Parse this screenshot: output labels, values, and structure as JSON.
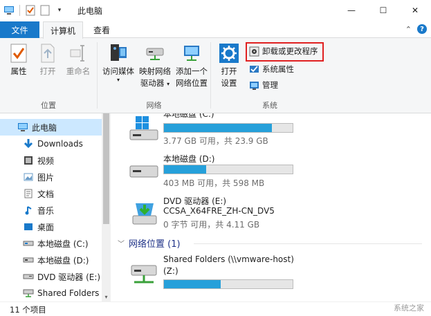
{
  "window": {
    "title": "此电脑",
    "controls": {
      "minimize": "—",
      "maximize": "☐",
      "close": "✕"
    }
  },
  "tabs": {
    "file": "文件",
    "computer": "计算机",
    "view": "查看"
  },
  "ribbon": {
    "location": {
      "label": "位置",
      "properties": "属性",
      "open": "打开",
      "rename": "重命名"
    },
    "network": {
      "label": "网络",
      "access_media": "访问媒体",
      "map_drive_line1": "映射网络",
      "map_drive_line2": "驱动器",
      "add_location_line1": "添加一个",
      "add_location_line2": "网络位置"
    },
    "system": {
      "label": "系统",
      "open_settings_line1": "打开",
      "open_settings_line2": "设置",
      "uninstall": "卸载或更改程序",
      "system_properties": "系统属性",
      "manage": "管理"
    }
  },
  "nav": {
    "items": [
      {
        "label": "此电脑",
        "icon": "computer-icon",
        "selected": true
      },
      {
        "label": "Downloads",
        "icon": "download-arrow-icon"
      },
      {
        "label": "视频",
        "icon": "video-icon"
      },
      {
        "label": "图片",
        "icon": "picture-icon"
      },
      {
        "label": "文档",
        "icon": "document-icon"
      },
      {
        "label": "音乐",
        "icon": "music-icon"
      },
      {
        "label": "桌面",
        "icon": "desktop-icon"
      },
      {
        "label": "本地磁盘 (C:)",
        "icon": "drive-icon"
      },
      {
        "label": "本地磁盘 (D:)",
        "icon": "drive-icon"
      },
      {
        "label": "DVD 驱动器 (E:)",
        "icon": "dvd-icon"
      },
      {
        "label": "Shared Folders",
        "icon": "network-drive-icon"
      }
    ]
  },
  "drives": [
    {
      "name": "本地磁盘 (C:)",
      "free": "3.77 GB 可用，共 23.9 GB",
      "used_fraction": 0.84,
      "icon": "windows-drive-icon"
    },
    {
      "name": "本地磁盘 (D:)",
      "free": "403 MB 可用，共 598 MB",
      "used_fraction": 0.33,
      "icon": "drive-icon"
    },
    {
      "name": "DVD 驱动器 (E:)",
      "label": "CCSA_X64FRE_ZH-CN_DV5",
      "free": "0 字节 可用，共 4.11 GB",
      "icon": "dvd-icon"
    }
  ],
  "network_section": {
    "title": "网络位置 (1)",
    "items": [
      {
        "name": "Shared Folders (\\\\vmware-host)",
        "sub": "(Z:)",
        "used_fraction": 0.44,
        "icon": "network-drive-icon"
      }
    ]
  },
  "status": {
    "count": "11 个项目"
  },
  "watermark": "系统之家",
  "colors": {
    "accent": "#1979ca",
    "bar_fill": "#26a0da",
    "highlight_box": "#e02020",
    "selection": "#cce8ff"
  }
}
